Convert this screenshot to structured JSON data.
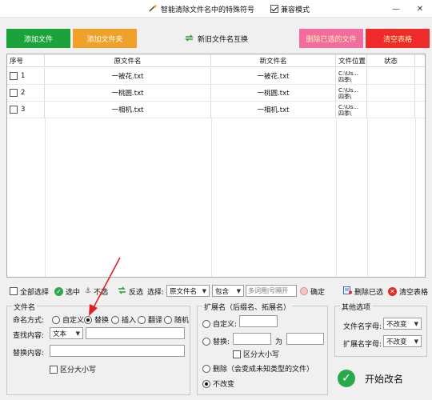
{
  "titlebar": {
    "title": "智能清除文件名中的特殊符号",
    "compat_label": "兼容模式",
    "compat_checked": true
  },
  "toolbar": {
    "add_file": "添加文件",
    "add_folder": "添加文件夹",
    "swap_names": "新旧文件名互换",
    "delete_selected": "删除已选的文件",
    "clear_table": "清空表格"
  },
  "table": {
    "headers": [
      "序号",
      "原文件名",
      "新文件名",
      "文件位置",
      "状态"
    ],
    "rows": [
      {
        "num": "1",
        "original": "一被花.txt",
        "new": "一被花.txt",
        "location": "C:\\Us...\n四季\\",
        "status": ""
      },
      {
        "num": "2",
        "original": "一桃圆.txt",
        "new": "一桃圆.txt",
        "location": "C:\\Us...\n四季\\",
        "status": ""
      },
      {
        "num": "3",
        "original": "一相机.txt",
        "new": "一相机.txt",
        "location": "C:\\Us...\n四季\\",
        "status": ""
      }
    ]
  },
  "selection": {
    "select_all": "全部选择",
    "select_middle": "选中",
    "deselect": "不选",
    "invert": "反选",
    "choose_label": "选择:",
    "field_option": "原文件名",
    "match_option": "包含",
    "keyword_placeholder": "多词用|号隔开",
    "confirm": "确定",
    "delete_selected": "删除已选",
    "clear_table": "清空表格"
  },
  "filename_group": {
    "title": "文件名",
    "mode_label": "命名方式:",
    "modes": [
      "自定义",
      "替换",
      "插入",
      "翻译",
      "随机"
    ],
    "selected_mode": "替换",
    "find_label": "查找内容:",
    "find_type": "文本",
    "replace_label": "替换内容:",
    "case_label": "区分大小写"
  },
  "extension_group": {
    "title": "扩展名（后缀名、拓展名）",
    "custom_label": "自定义:",
    "replace_label": "替换:",
    "to_label": "为",
    "case_label": "区分大小写",
    "delete_label": "删除（会变成未知类型的文件）",
    "keep_label": "不改变",
    "selected": "不改变"
  },
  "other_group": {
    "title": "其他选项",
    "filename_case_label": "文件名字母:",
    "filename_case_value": "不改变",
    "ext_case_label": "扩展名字母:",
    "ext_case_value": "不改变"
  },
  "start": {
    "label": "开始改名"
  },
  "colors": {
    "add_file": "#1aa33a",
    "add_folder": "#f0a12a",
    "delete_selected": "#f26ca0",
    "clear_table": "#ee2a2a",
    "arrow": "#e02020"
  }
}
